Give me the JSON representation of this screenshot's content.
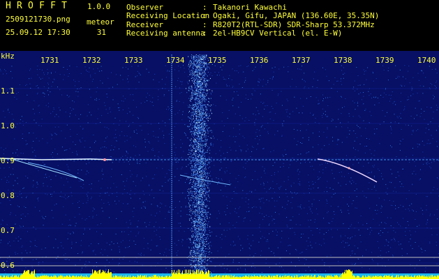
{
  "header": {
    "app_title": "HROFFT",
    "version": "1.0.0",
    "filename": "2509121730.png",
    "datetime": "25.09.12 17:30",
    "meteor_label": "meteor",
    "meteor_count": "31"
  },
  "info": [
    {
      "label": "Observer",
      "value": "Takanori Kawachi"
    },
    {
      "label": "Receiving Location",
      "value": "Ogaki, Gifu, JAPAN (136.60E, 35.35N)"
    },
    {
      "label": "Receiver",
      "value": "R820T2(RTL-SDR) SDR-Sharp 53.372MHz"
    },
    {
      "label": "Receiving antenna",
      "value": "2el-HB9CV Vertical (el. E-W)"
    }
  ],
  "info_separator": ":",
  "axes": {
    "y_unit": "kHz",
    "x_labels": [
      "1731",
      "1732",
      "1733",
      "1734",
      "1735",
      "1736",
      "1737",
      "1738",
      "1739",
      "1740"
    ],
    "y_labels": [
      "1.1",
      "1.0",
      "0.9",
      "0.8",
      "0.7",
      "0.6"
    ]
  },
  "colors": {
    "text": "#ffff3a",
    "background": "#000000",
    "spectrum_bg": "#071064",
    "noise_band": "#3f7df0",
    "meteor_trace": "#e8f8ff"
  }
}
